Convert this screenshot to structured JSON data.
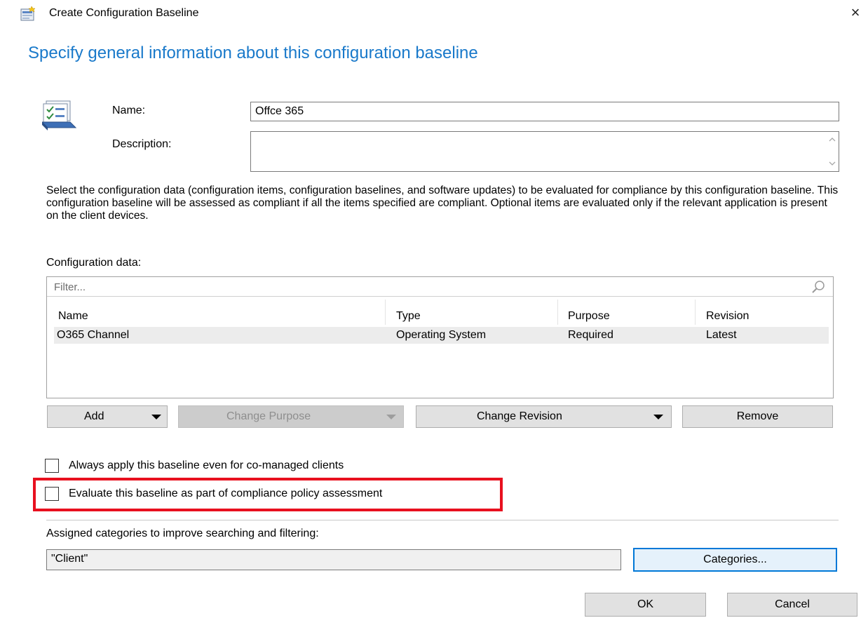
{
  "window": {
    "title": "Create Configuration Baseline",
    "close_glyph": "×",
    "title_icon": "configuration-baseline-icon"
  },
  "heading": "Specify general information about this configuration baseline",
  "form": {
    "name_label": "Name:",
    "name_value": "Offce 365",
    "description_label": "Description:",
    "description_value": ""
  },
  "instructions": "Select the configuration data (configuration items, configuration baselines, and software updates) to be evaluated for compliance by this configuration baseline. This configuration baseline will be assessed as compliant if all the items specified are compliant. Optional items are evaluated only if the relevant application is present on  the client devices.",
  "config_data": {
    "label": "Configuration data:",
    "filter_placeholder": "Filter...",
    "columns": [
      "Name",
      "Type",
      "Purpose",
      "Revision"
    ],
    "rows": [
      {
        "name": "O365 Channel",
        "type": "Operating System",
        "purpose": "Required",
        "revision": "Latest"
      }
    ]
  },
  "buttons": {
    "add": "Add",
    "change_purpose": "Change Purpose",
    "change_revision": "Change Revision",
    "remove": "Remove",
    "categories": "Categories...",
    "ok": "OK",
    "cancel": "Cancel"
  },
  "checkboxes": {
    "always_apply": {
      "label": "Always apply this baseline even for co-managed clients",
      "checked": false
    },
    "evaluate": {
      "label": "Evaluate this baseline as part of compliance policy assessment",
      "checked": false
    }
  },
  "categories": {
    "label": "Assigned categories to improve searching and filtering:",
    "value": "\"Client\""
  },
  "colors": {
    "heading": "#1979ca",
    "highlight": "#e8101f",
    "focus": "#0078d7"
  }
}
